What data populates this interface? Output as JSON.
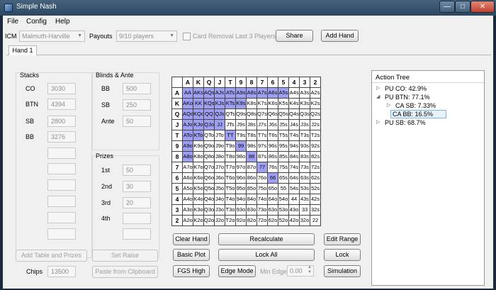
{
  "window": {
    "title": "Simple Nash",
    "minimize": "—",
    "maximize": "□",
    "close": "✕"
  },
  "menu": {
    "file": "File",
    "config": "Config",
    "help": "Help"
  },
  "toolbar": {
    "icm_label": "ICM",
    "icm_value": "Malmuth-Harville",
    "payouts_label": "Payouts",
    "payouts_value": "9/10 players",
    "card_removal_label": "Card Removal Last 3 Players",
    "share": "Share",
    "add_hand": "Add Hand"
  },
  "tabs": {
    "hand1": "Hand 1"
  },
  "stacks": {
    "title": "Stacks",
    "rows": [
      {
        "label": "CO",
        "value": "3030"
      },
      {
        "label": "BTN",
        "value": "4394"
      },
      {
        "label": "SB",
        "value": "2800"
      },
      {
        "label": "BB",
        "value": "3276"
      }
    ]
  },
  "blinds": {
    "title": "Blinds & Ante",
    "rows": [
      {
        "label": "BB",
        "value": "500"
      },
      {
        "label": "SB",
        "value": "250"
      },
      {
        "label": "Ante",
        "value": "50"
      }
    ]
  },
  "prizes": {
    "title": "Prizes",
    "rows": [
      {
        "label": "1st",
        "value": "50"
      },
      {
        "label": "2nd",
        "value": "30"
      },
      {
        "label": "3rd",
        "value": "20"
      },
      {
        "label": "4th",
        "value": ""
      }
    ]
  },
  "left_buttons": {
    "add_table": "Add Table and Prizes",
    "set_raise": "Set Raise",
    "chips_label": "Chips",
    "chips_value": "13500",
    "paste": "Paste from Clipboard"
  },
  "grid": {
    "ranks": [
      "A",
      "K",
      "Q",
      "J",
      "T",
      "9",
      "8",
      "7",
      "6",
      "5",
      "4",
      "3",
      "2"
    ],
    "highlight_color": "#9f9ff2",
    "rows": [
      {
        "label": "A",
        "cells": [
          "AA",
          "AKs",
          "AQs",
          "AJs",
          "ATs",
          "A9s",
          "A8s",
          "A7s",
          "A6s",
          "A5s",
          "A4s",
          "A3s",
          "A2s"
        ],
        "on": [
          1,
          1,
          1,
          1,
          1,
          1,
          1,
          1,
          1,
          1,
          0,
          0,
          0
        ]
      },
      {
        "label": "K",
        "cells": [
          "AKo",
          "KK",
          "KQs",
          "KJs",
          "KTs",
          "K9s",
          "K8s",
          "K7s",
          "K6s",
          "K5s",
          "K4s",
          "K3s",
          "K2s"
        ],
        "on": [
          1,
          1,
          1,
          1,
          1,
          1,
          0,
          0,
          0,
          0,
          0,
          0,
          0
        ]
      },
      {
        "label": "Q",
        "cells": [
          "AQo",
          "KQo",
          "QQ",
          "QJs",
          "QTs",
          "Q9s",
          "Q8s",
          "Q7s",
          "Q6s",
          "Q5s",
          "Q4s",
          "Q3s",
          "Q2s"
        ],
        "on": [
          1,
          1,
          1,
          1,
          0,
          0,
          0,
          0,
          0,
          0,
          0,
          0,
          0
        ]
      },
      {
        "label": "J",
        "cells": [
          "AJo",
          "KJo",
          "QJo",
          "JJ",
          "JTs",
          "J9s",
          "J8s",
          "J7s",
          "J6s",
          "J5s",
          "J4s",
          "J3s",
          "J2s"
        ],
        "on": [
          1,
          1,
          1,
          1,
          0,
          0,
          0,
          0,
          0,
          0,
          0,
          0,
          0
        ]
      },
      {
        "label": "T",
        "cells": [
          "ATo",
          "KTo",
          "QTo",
          "JTo",
          "TT",
          "T9s",
          "T8s",
          "T7s",
          "T6s",
          "T5s",
          "T4s",
          "T3s",
          "T2s"
        ],
        "on": [
          1,
          1,
          0,
          0,
          1,
          0,
          0,
          0,
          0,
          0,
          0,
          0,
          0
        ]
      },
      {
        "label": "9",
        "cells": [
          "A9o",
          "K9o",
          "Q9o",
          "J9o",
          "T9o",
          "99",
          "98s",
          "97s",
          "96s",
          "95s",
          "94s",
          "93s",
          "92s"
        ],
        "on": [
          1,
          0,
          0,
          0,
          0,
          1,
          0,
          0,
          0,
          0,
          0,
          0,
          0
        ]
      },
      {
        "label": "8",
        "cells": [
          "A8o",
          "K8o",
          "Q8o",
          "J8o",
          "T8o",
          "98o",
          "88",
          "87s",
          "86s",
          "85s",
          "84s",
          "83s",
          "82s"
        ],
        "on": [
          1,
          0,
          0,
          0,
          0,
          0,
          1,
          0,
          0,
          0,
          0,
          0,
          0
        ]
      },
      {
        "label": "7",
        "cells": [
          "A7o",
          "K7o",
          "Q7o",
          "J7o",
          "T7o",
          "97o",
          "87o",
          "77",
          "76s",
          "75s",
          "74s",
          "73s",
          "72s"
        ],
        "on": [
          0,
          0,
          0,
          0,
          0,
          0,
          0,
          1,
          0,
          0,
          0,
          0,
          0
        ]
      },
      {
        "label": "6",
        "cells": [
          "A6o",
          "K6o",
          "Q6o",
          "J6o",
          "T6o",
          "96o",
          "86o",
          "76o",
          "66",
          "65s",
          "64s",
          "63s",
          "62s"
        ],
        "on": [
          0,
          0,
          0,
          0,
          0,
          0,
          0,
          0,
          1,
          0,
          0,
          0,
          0
        ]
      },
      {
        "label": "5",
        "cells": [
          "A5o",
          "K5o",
          "Q5o",
          "J5o",
          "T5o",
          "95o",
          "85o",
          "75o",
          "65o",
          "55",
          "54s",
          "53s",
          "52s"
        ],
        "on": [
          0,
          0,
          0,
          0,
          0,
          0,
          0,
          0,
          0,
          0,
          0,
          0,
          0
        ]
      },
      {
        "label": "4",
        "cells": [
          "A4o",
          "K4o",
          "Q4o",
          "J4o",
          "T4o",
          "94o",
          "84o",
          "74o",
          "64o",
          "54o",
          "44",
          "43s",
          "42s"
        ],
        "on": [
          0,
          0,
          0,
          0,
          0,
          0,
          0,
          0,
          0,
          0,
          0,
          0,
          0
        ]
      },
      {
        "label": "3",
        "cells": [
          "A3o",
          "K3o",
          "Q3o",
          "J3o",
          "T3o",
          "93o",
          "83o",
          "73o",
          "63o",
          "53o",
          "43o",
          "33",
          "32s"
        ],
        "on": [
          0,
          0,
          0,
          0,
          0,
          0,
          0,
          0,
          0,
          0,
          0,
          0,
          0
        ]
      },
      {
        "label": "2",
        "cells": [
          "A2o",
          "K2o",
          "Q2o",
          "J2o",
          "T2o",
          "92o",
          "82o",
          "72o",
          "62o",
          "52o",
          "42o",
          "32o",
          "22"
        ],
        "on": [
          0,
          0,
          0,
          0,
          0,
          0,
          0,
          0,
          0,
          0,
          0,
          0,
          0
        ]
      }
    ]
  },
  "grid_buttons": {
    "clear_hand": "Clear Hand",
    "recalculate": "Recalculate",
    "edit_range": "Edit Range",
    "basic_plot": "Basic Plot",
    "lock_all": "Lock All",
    "lock": "Lock",
    "fgs_high": "FGS High",
    "edge_mode": "Edge Mode",
    "min_edge_label": "Min Edge",
    "min_edge_value": "0.00",
    "simulation": "Simulation"
  },
  "action_tree": {
    "title": "Action Tree",
    "nodes": [
      {
        "text": "PU CO: 42.9%",
        "arrow": "▷",
        "level": 0
      },
      {
        "text": "PU BTN: 77.1%",
        "arrow": "◢",
        "level": 0
      },
      {
        "text": "CA SB: 7.33%",
        "arrow": "▷",
        "level": 1
      },
      {
        "text": "CA BB: 16.5%",
        "arrow": "",
        "level": 1,
        "selected": true
      },
      {
        "text": "PU SB: 68.7%",
        "arrow": "▷",
        "level": 0
      }
    ]
  }
}
